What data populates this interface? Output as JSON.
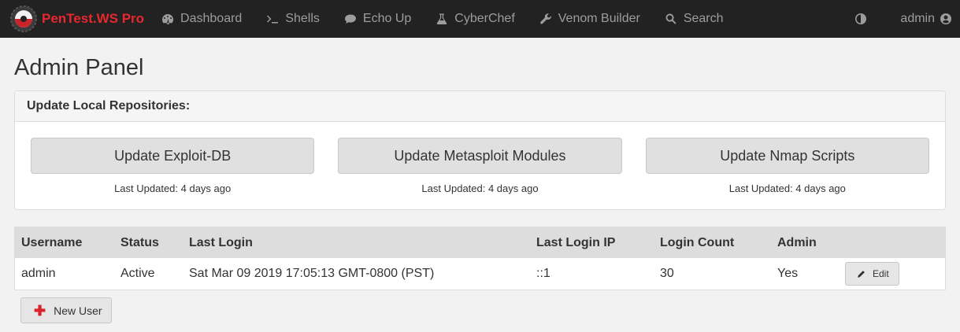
{
  "nav": {
    "brand": "PenTest.WS Pro",
    "items": [
      {
        "label": "Dashboard",
        "icon": "dashboard-icon"
      },
      {
        "label": "Shells",
        "icon": "terminal-icon"
      },
      {
        "label": "Echo Up",
        "icon": "comment-icon"
      },
      {
        "label": "CyberChef",
        "icon": "flask-icon"
      },
      {
        "label": "Venom Builder",
        "icon": "wrench-icon"
      },
      {
        "label": "Search",
        "icon": "search-icon"
      }
    ],
    "user": "admin"
  },
  "page": {
    "title": "Admin Panel"
  },
  "repos": {
    "heading": "Update Local Repositories:",
    "items": [
      {
        "button": "Update Exploit-DB",
        "last_updated": "Last Updated: 4 days ago"
      },
      {
        "button": "Update Metasploit Modules",
        "last_updated": "Last Updated: 4 days ago"
      },
      {
        "button": "Update Nmap Scripts",
        "last_updated": "Last Updated: 4 days ago"
      }
    ]
  },
  "users_table": {
    "headers": [
      "Username",
      "Status",
      "Last Login",
      "Last Login IP",
      "Login Count",
      "Admin"
    ],
    "rows": [
      {
        "username": "admin",
        "status": "Active",
        "last_login": "Sat Mar 09 2019 17:05:13 GMT-0800 (PST)",
        "last_login_ip": "::1",
        "login_count": "30",
        "admin": "Yes",
        "edit_label": "Edit"
      }
    ]
  },
  "new_user_label": "New User",
  "colors": {
    "navbar": "#222222",
    "brand": "#e8272e",
    "page_bg": "#f2f2f2",
    "table_header": "#dddddd",
    "plus": "#d9232a"
  }
}
